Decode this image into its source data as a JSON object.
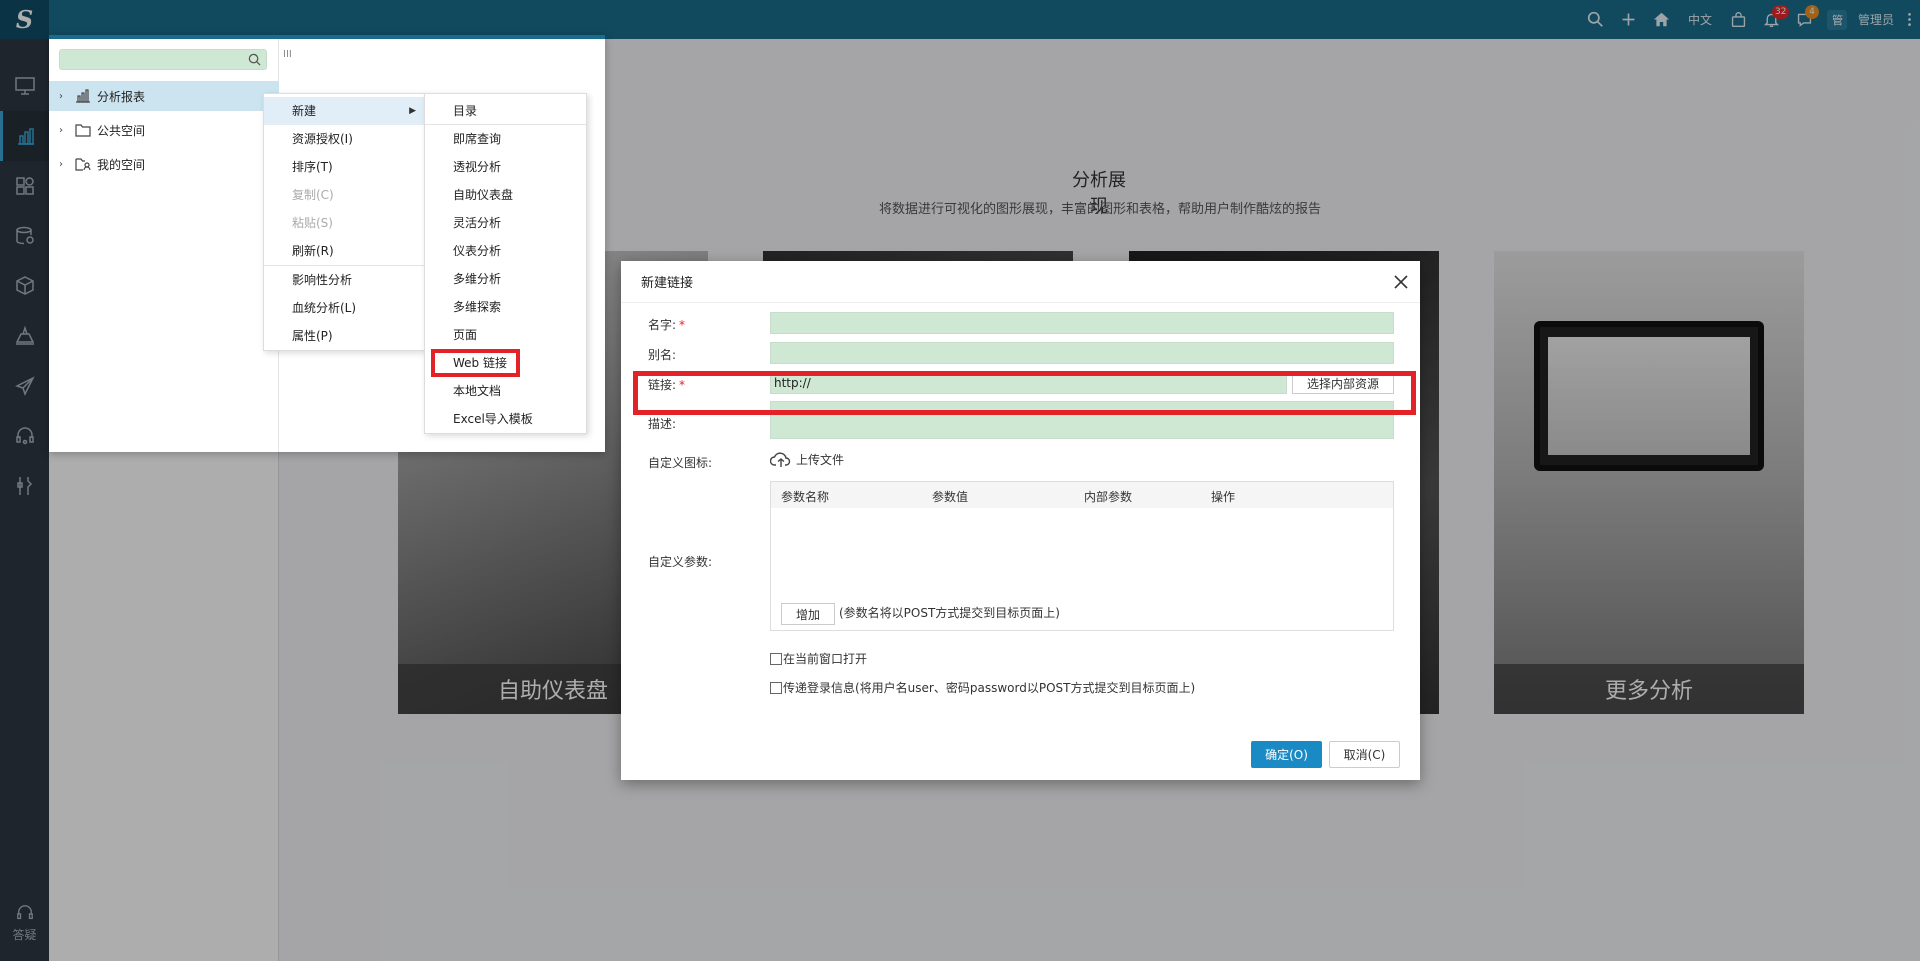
{
  "topbar": {
    "logo": "S",
    "lang": "中文",
    "bell_count": "32",
    "message_count": "4",
    "avatar_text": "管",
    "username": "管理员"
  },
  "rail": {
    "help_label": "答疑"
  },
  "background": {
    "intro_title": "分析展现",
    "intro_subtitle": "将数据进行可视化的图形展现，丰富的图形和表格，帮助用户制作酷炫的报告",
    "cards": [
      "自助仪表盘",
      "",
      "",
      "更多分析"
    ]
  },
  "tree": {
    "search_placeholder": "",
    "items": [
      {
        "label": "分析报表"
      },
      {
        "label": "公共空间"
      },
      {
        "label": "我的空间"
      }
    ],
    "splitter": "III"
  },
  "context_menu": {
    "items": [
      "新建",
      "资源授权(I)",
      "排序(T)",
      "复制(C)",
      "粘贴(S)",
      "刷新(R)",
      "影响性分析",
      "血统分析(L)",
      "属性(P)"
    ]
  },
  "submenu": {
    "items": [
      "目录",
      "即席查询",
      "透视分析",
      "自助仪表盘",
      "灵活分析",
      "仪表分析",
      "多维分析",
      "多维探索",
      "页面",
      "Web 链接",
      "本地文档",
      "Excel导入模板"
    ]
  },
  "dialog": {
    "title": "新建链接",
    "name_label": "名字:",
    "alias_label": "别名:",
    "link_label": "链接:",
    "link_value": "http://",
    "pick_resource": "选择内部资源",
    "desc_label": "描述:",
    "icon_label": "自定义图标:",
    "upload_label": "上传文件",
    "params_label": "自定义参数:",
    "param_columns": [
      "参数名称",
      "参数值",
      "内部参数",
      "操作"
    ],
    "add_button": "增加",
    "add_note": "(参数名将以POST方式提交到目标页面上)",
    "open_current": "在当前窗口打开",
    "pass_login": "传递登录信息(将用户名user、密码password以POST方式提交到目标页面上)",
    "ok": "确定(O)",
    "cancel": "取消(C)"
  },
  "colors": {
    "topbar": "#1a6c8c",
    "rail": "#2e3743",
    "accent": "#1a8ac4",
    "highlight_red": "#e32228",
    "field_green": "#cfe8d3"
  }
}
